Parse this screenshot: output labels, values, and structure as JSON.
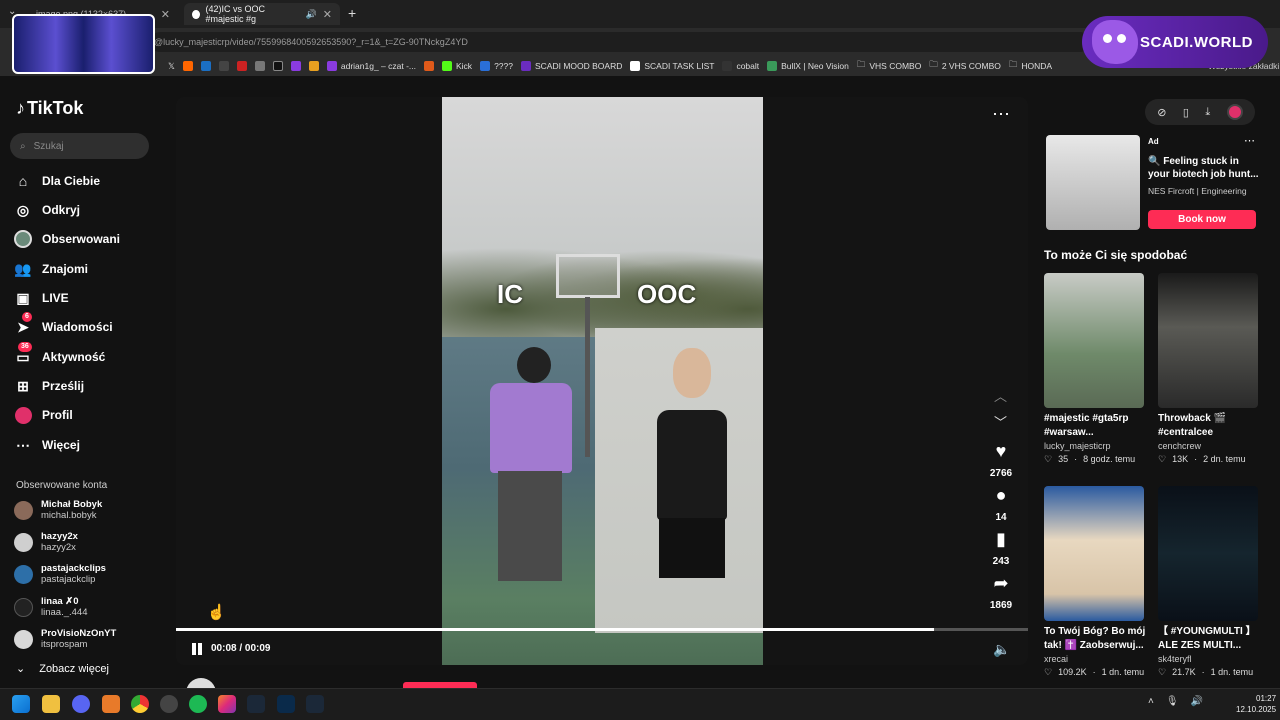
{
  "browser": {
    "tabs": [
      {
        "title": "image.png (1132×637)",
        "active": false
      },
      {
        "title": "(42)IC vs OOC #majestic #g",
        "active": true
      }
    ],
    "new_tab": "+",
    "url": "@lucky_majesticrp/video/7559968400592653590?_r=1&_t=ZG-90TNckgZ4YD",
    "bookmarks": [
      "adrian1g_ – czat -...",
      "Kick",
      "????",
      "SCADI MOOD BOARD",
      "SCADI TASK LIST",
      "cobalt",
      "BullX | Neo Vision",
      "VHS COMBO",
      "2 VHS COMBO",
      "HONDA",
      "Wszystkie zakładki"
    ],
    "overlay_brand": "SCADI.WORLD"
  },
  "sidebar": {
    "logo": "TikTok",
    "search_placeholder": "Szukaj",
    "nav": [
      {
        "label": "Dla Ciebie",
        "icon": "home-icon"
      },
      {
        "label": "Odkryj",
        "icon": "compass-icon"
      },
      {
        "label": "Obserwowani",
        "icon": "following-avatar-icon"
      },
      {
        "label": "Znajomi",
        "icon": "friends-icon"
      },
      {
        "label": "LIVE",
        "icon": "live-icon"
      },
      {
        "label": "Wiadomości",
        "icon": "messages-icon",
        "badge": "6"
      },
      {
        "label": "Aktywność",
        "icon": "activity-icon",
        "badge": "36"
      },
      {
        "label": "Prześlij",
        "icon": "upload-icon"
      },
      {
        "label": "Profil",
        "icon": "profile-icon"
      },
      {
        "label": "Więcej",
        "icon": "more-icon"
      }
    ],
    "following_header": "Obserwowane konta",
    "accounts": [
      {
        "name": "Michał Bobyk",
        "user": "michal.bobyk",
        "color": "#8a6a5a"
      },
      {
        "name": "hazyy2x",
        "user": "hazyy2x",
        "color": "#cfcfcf"
      },
      {
        "name": "pastajackclips",
        "user": "pastajackclip",
        "color": "#2d6fa8"
      },
      {
        "name": "linaa ✗0",
        "user": "linaa._.444",
        "color": "#222222"
      },
      {
        "name": "ProVisioNzOnYT",
        "user": "itsprospam",
        "color": "#d8d8d8"
      }
    ],
    "see_more": "Zobacz więcej"
  },
  "video": {
    "label_ic": "IC",
    "label_ooc": "OOC",
    "time": "00:08 / 00:09",
    "progress": 0.89,
    "likes": "2766",
    "comments": "14",
    "saves": "243",
    "shares": "1869",
    "author": "lucky_majesticrp"
  },
  "right": {
    "ad": {
      "label": "Ad",
      "title": "🔍 Feeling stuck in your biotech job hunt...",
      "brand": "NES Fircroft | Engineering",
      "cta": "Book now"
    },
    "recommend_title": "To może Ci się spodobać",
    "cards": [
      {
        "title": "#majestic #gta5rp #warsaw...",
        "user": "lucky_majesticrp",
        "likes": "35",
        "age": "8 godz. temu",
        "color": "#6f8a6a"
      },
      {
        "title": "Throwback 🎬 #centralcee",
        "user": "cenchcrew",
        "likes": "13K",
        "age": "2 dn. temu",
        "color": "#3b3b3b"
      },
      {
        "title": "To Twój Bóg? Bo mój tak! ✝️ Zaobserwuj...",
        "user": "xrecai",
        "likes": "109.2K",
        "age": "1 dn. temu",
        "color": "#4a78b0"
      },
      {
        "title": "【 #YOUNGMULTI 】 ALE ZES MULTI...",
        "user": "sk4teryfl",
        "likes": "21.7K",
        "age": "1 dn. temu",
        "color": "#0d1520"
      }
    ]
  },
  "taskbar": {
    "time": "01:27",
    "date": "12.10.2025"
  }
}
